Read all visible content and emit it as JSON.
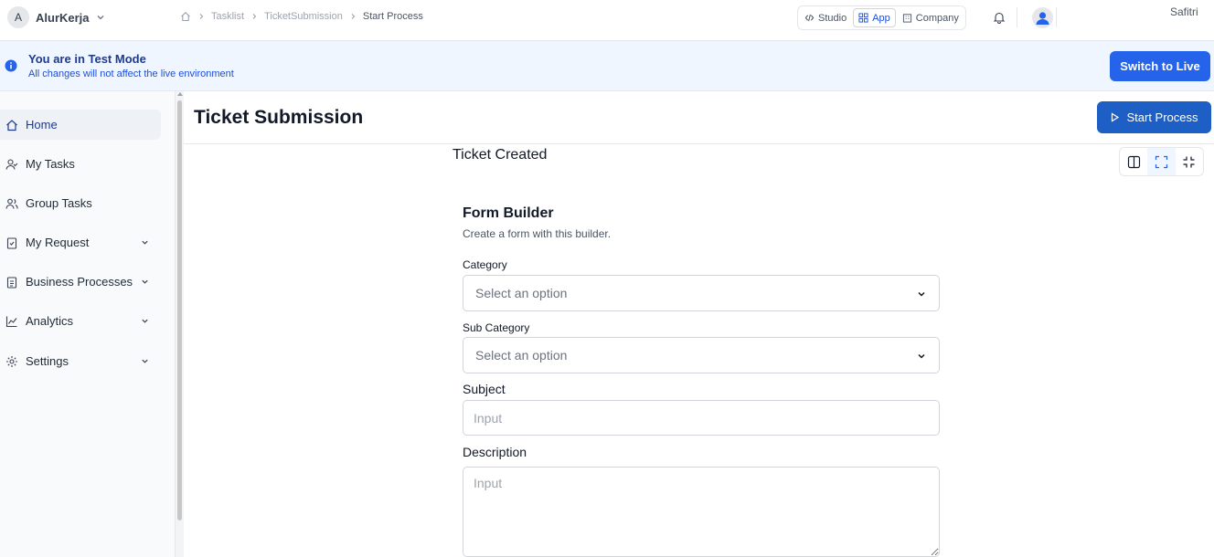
{
  "workspace": {
    "avatar_letter": "A",
    "name": "AlurKerja"
  },
  "breadcrumbs": [
    "Tasklist",
    "TicketSubmission",
    "Start Process"
  ],
  "modes": {
    "studio": "Studio",
    "app": "App",
    "company": "Company",
    "active": "App"
  },
  "user": {
    "name": "Safitri"
  },
  "banner": {
    "title": "You are in Test Mode",
    "subtitle": "All changes will not affect the live environment",
    "button": "Switch to Live"
  },
  "sidebar": {
    "items": [
      {
        "label": "Home",
        "icon": "home-icon",
        "active": true,
        "expandable": false
      },
      {
        "label": "My Tasks",
        "icon": "user-check-icon",
        "expandable": false
      },
      {
        "label": "Group Tasks",
        "icon": "users-icon",
        "expandable": false
      },
      {
        "label": "My Request",
        "icon": "clipboard-check-icon",
        "expandable": true
      },
      {
        "label": "Business Processes",
        "icon": "clipboard-list-icon",
        "expandable": true
      },
      {
        "label": "Analytics",
        "icon": "line-chart-icon",
        "expandable": true
      },
      {
        "label": "Settings",
        "icon": "gear-icon",
        "expandable": true
      }
    ]
  },
  "main": {
    "title": "Ticket Submission",
    "start_button": "Start Process",
    "subtitle": "Ticket Created"
  },
  "form": {
    "title": "Form Builder",
    "description": "Create a form with this builder.",
    "category": {
      "label": "Category",
      "placeholder": "Select an option"
    },
    "sub_category": {
      "label": "Sub Category",
      "placeholder": "Select an option"
    },
    "subject": {
      "label": "Subject",
      "placeholder": "Input",
      "value": ""
    },
    "description_field": {
      "label": "Description",
      "placeholder": "Input",
      "value": ""
    }
  },
  "colors": {
    "accent": "#2563eb",
    "banner_bg": "#eff6ff",
    "sidebar_bg": "#f8fafc"
  }
}
